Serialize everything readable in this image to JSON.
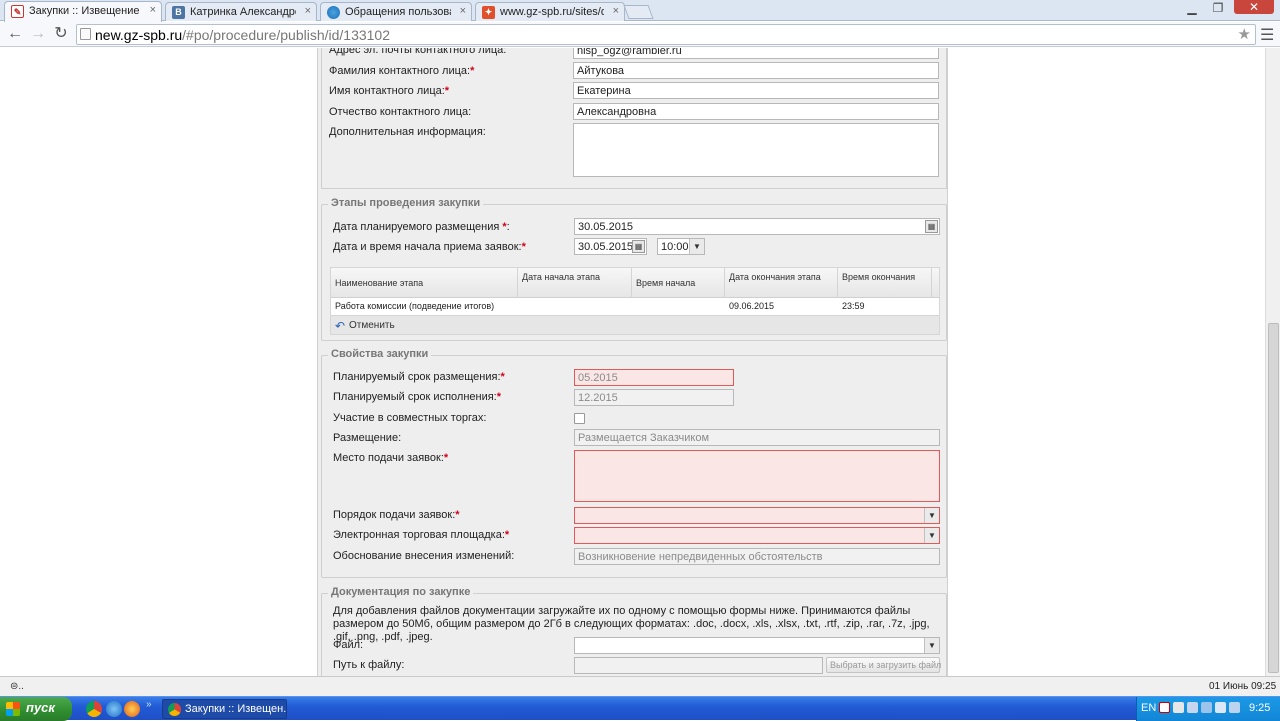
{
  "browser": {
    "tabs": [
      {
        "title": "Закупки :: Извещение о пр",
        "active": true,
        "favicon": "procurement-icon"
      },
      {
        "title": "Катринка Александровна",
        "active": false,
        "favicon": "vk-icon"
      },
      {
        "title": "Обращения пользовател",
        "active": false,
        "favicon": "globe-icon"
      },
      {
        "title": "www.gz-spb.ru/sites/default",
        "active": false,
        "favicon": "spb-icon"
      }
    ],
    "url_host": "new.gz-spb.ru",
    "url_path": "/#po/procedure/publish/id/133102"
  },
  "contact": {
    "email_label": "Адрес эл. почты контактного лица:",
    "email_value": "nisp_ogz@rambler.ru",
    "lastname_label": "Фамилия контактного лица:",
    "lastname_value": "Айтукова",
    "firstname_label": "Имя контактного лица:",
    "firstname_value": "Екатерина",
    "patronymic_label": "Отчество контактного лица:",
    "patronymic_value": "Александровна",
    "extra_label": "Дополнительная информация:",
    "extra_value": ""
  },
  "stages": {
    "legend": "Этапы проведения закупки",
    "planned_date_label": "Дата планируемого размещения ",
    "planned_date_colon": ":",
    "planned_date_value": "30.05.2015",
    "start_label": "Дата и время начала приема заявок:",
    "start_date_value": "30.05.2015",
    "start_time_value": "10:00",
    "table_headers": [
      "Наименование этапа",
      "Дата начала этапа",
      "Время начала",
      "Дата окончания этапа",
      "Время окончания"
    ],
    "rows": [
      {
        "name": "Работа комиссии (подведение итогов)",
        "start_date": "",
        "start_time": "",
        "end_date": "09.06.2015",
        "end_time": "23:59"
      }
    ],
    "undo_label": "Отменить"
  },
  "properties": {
    "legend": "Свойства закупки",
    "placement_term_label": "Планируемый срок размещения:",
    "placement_term_value": "05.2015",
    "execution_term_label": "Планируемый срок исполнения:",
    "execution_term_value": "12.2015",
    "joint_label": "Участие в совместных торгах:",
    "joint_checked": false,
    "placement_label": "Размещение:",
    "placement_value": "Размещается Заказчиком",
    "submission_place_label": "Место подачи заявок:",
    "submission_place_value": "",
    "submission_order_label": "Порядок подачи заявок:",
    "submission_order_value": "",
    "etp_label": "Электронная торговая площадка:",
    "etp_value": "",
    "change_reason_label": "Обоснование внесения изменений:",
    "change_reason_value": "Возникновение непредвиденных обстоятельств"
  },
  "docs": {
    "legend": "Документация по закупке",
    "note": "Для добавления файлов документации загружайте их по одному с помощью формы ниже. Принимаются файлы размером до 50Мб, общим размером до 2Гб в следующих форматах: .doc, .docx, .xls, .xlsx, .txt, .rtf, .zip, .rar, .7z, .jpg, .gif, .png, .pdf, .jpeg.",
    "file_label": "Файл:",
    "path_label": "Путь к файлу:",
    "upload_button": "Выбрать и загрузить файл"
  },
  "taskbar": {
    "start": "пуск",
    "task": "Закупки :: Извещен...",
    "lang": "EN",
    "clock": "9:25",
    "status_date": "01 Июнь 09:25"
  },
  "colors": {
    "required": "#d0021b",
    "error_border": "#e15a5a",
    "error_bg": "#fbe6e6",
    "taskbar": "#225bd6",
    "start_green": "#2f8c2f"
  }
}
